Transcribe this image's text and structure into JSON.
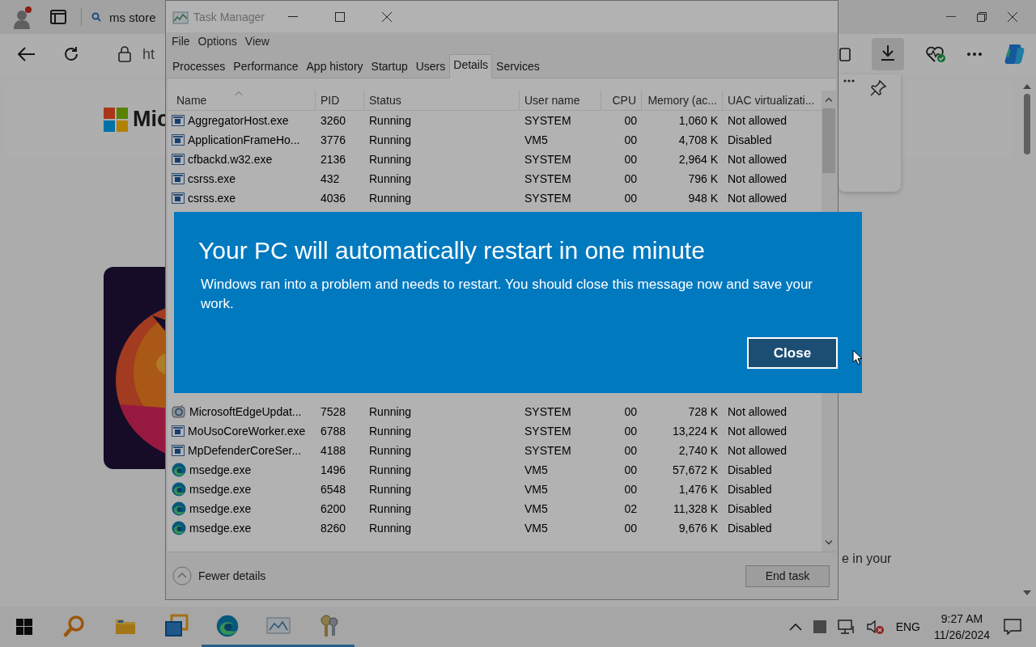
{
  "browser": {
    "tab": {
      "title": "ms store"
    },
    "address": {
      "value": "ht"
    },
    "page": {
      "brand": "Mic",
      "footer_text": "e in your"
    }
  },
  "task_manager": {
    "title": "Task Manager",
    "menu": [
      "File",
      "Options",
      "View"
    ],
    "tabs": [
      {
        "label": "Processes",
        "selected": false
      },
      {
        "label": "Performance",
        "selected": false
      },
      {
        "label": "App history",
        "selected": false
      },
      {
        "label": "Startup",
        "selected": false
      },
      {
        "label": "Users",
        "selected": false
      },
      {
        "label": "Details",
        "selected": true
      },
      {
        "label": "Services",
        "selected": false
      }
    ],
    "columns": [
      "Name",
      "PID",
      "Status",
      "User name",
      "CPU",
      "Memory (ac...",
      "UAC virtualizati..."
    ],
    "rows_top": [
      {
        "kind": "app",
        "name": "AggregatorHost.exe",
        "pid": "3260",
        "status": "Running",
        "user": "SYSTEM",
        "cpu": "00",
        "memory": "1,060 K",
        "uac": "Not allowed"
      },
      {
        "kind": "app",
        "name": "ApplicationFrameHo...",
        "pid": "3776",
        "status": "Running",
        "user": "VM5",
        "cpu": "00",
        "memory": "4,708 K",
        "uac": "Disabled"
      },
      {
        "kind": "app",
        "name": "cfbackd.w32.exe",
        "pid": "2136",
        "status": "Running",
        "user": "SYSTEM",
        "cpu": "00",
        "memory": "2,964 K",
        "uac": "Not allowed"
      },
      {
        "kind": "app",
        "name": "csrss.exe",
        "pid": "432",
        "status": "Running",
        "user": "SYSTEM",
        "cpu": "00",
        "memory": "796 K",
        "uac": "Not allowed"
      },
      {
        "kind": "app",
        "name": "csrss.exe",
        "pid": "4036",
        "status": "Running",
        "user": "SYSTEM",
        "cpu": "00",
        "memory": "948 K",
        "uac": "Not allowed"
      }
    ],
    "rows_bottom": [
      {
        "kind": "updater",
        "name": "MicrosoftEdgeUpdat...",
        "pid": "7528",
        "status": "Running",
        "user": "SYSTEM",
        "cpu": "00",
        "memory": "728 K",
        "uac": "Not allowed"
      },
      {
        "kind": "app",
        "name": "MoUsoCoreWorker.exe",
        "pid": "6788",
        "status": "Running",
        "user": "SYSTEM",
        "cpu": "00",
        "memory": "13,224 K",
        "uac": "Not allowed"
      },
      {
        "kind": "app",
        "name": "MpDefenderCoreSer...",
        "pid": "4188",
        "status": "Running",
        "user": "SYSTEM",
        "cpu": "00",
        "memory": "2,740 K",
        "uac": "Not allowed"
      },
      {
        "kind": "edge",
        "name": "msedge.exe",
        "pid": "1496",
        "status": "Running",
        "user": "VM5",
        "cpu": "00",
        "memory": "57,672 K",
        "uac": "Disabled"
      },
      {
        "kind": "edge",
        "name": "msedge.exe",
        "pid": "6548",
        "status": "Running",
        "user": "VM5",
        "cpu": "00",
        "memory": "1,476 K",
        "uac": "Disabled"
      },
      {
        "kind": "edge",
        "name": "msedge.exe",
        "pid": "6200",
        "status": "Running",
        "user": "VM5",
        "cpu": "02",
        "memory": "11,328 K",
        "uac": "Disabled"
      },
      {
        "kind": "edge",
        "name": "msedge.exe",
        "pid": "8260",
        "status": "Running",
        "user": "VM5",
        "cpu": "00",
        "memory": "9,676 K",
        "uac": "Disabled"
      }
    ],
    "footer": {
      "toggle": "Fewer details",
      "button": "End task"
    }
  },
  "dialog": {
    "title": "Your PC will automatically restart in one minute",
    "message": "Windows ran into a problem and needs to restart. You should close this message now and save your work.",
    "button": "Close"
  },
  "taskbar": {
    "apps": [
      {
        "kind": "search",
        "running": false
      },
      {
        "kind": "folder",
        "running": false
      },
      {
        "kind": "windows",
        "running": false
      },
      {
        "kind": "edge",
        "running": true
      },
      {
        "kind": "monitor",
        "running": true
      },
      {
        "kind": "keys",
        "running": true
      }
    ],
    "language": "ENG",
    "clock": {
      "time": "9:27 AM",
      "date": "11/26/2024"
    }
  }
}
